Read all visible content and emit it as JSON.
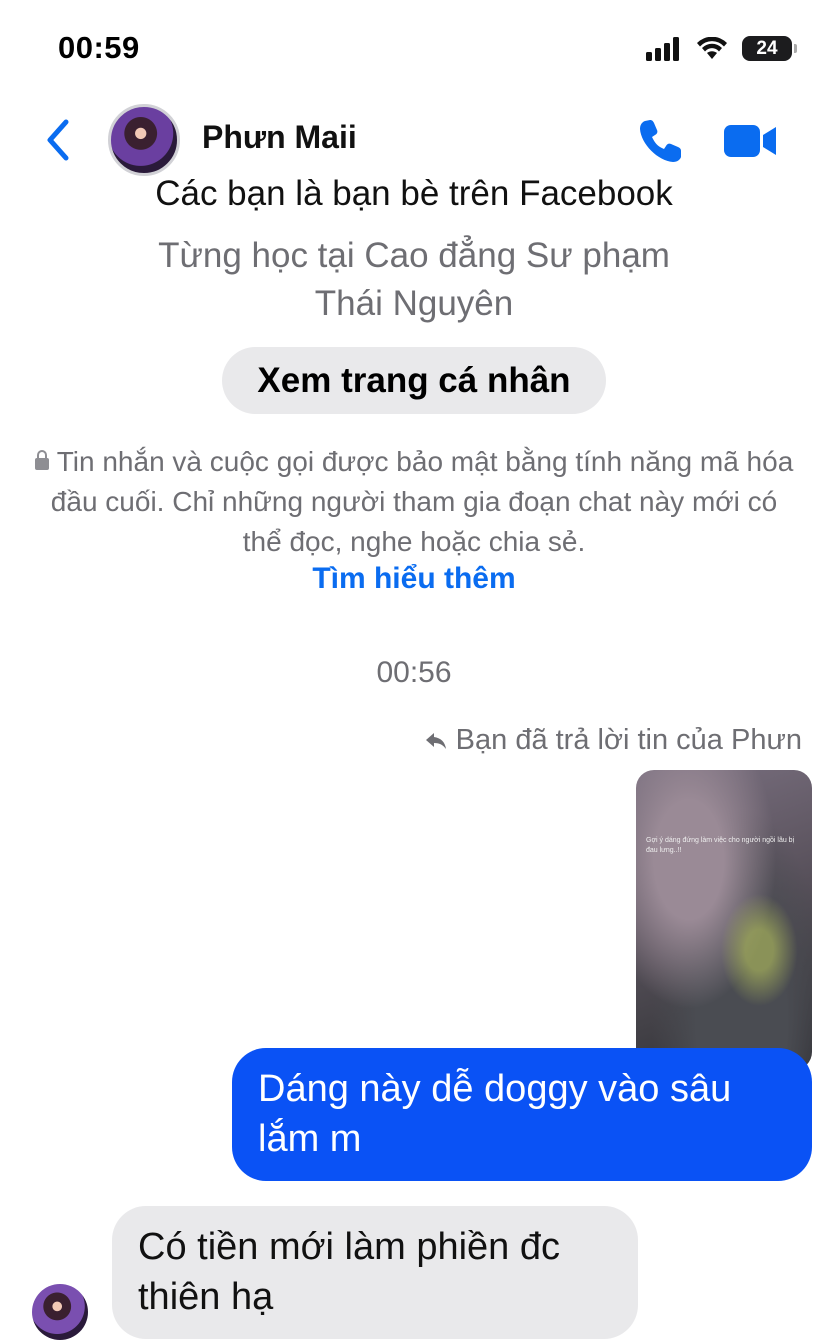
{
  "status_bar": {
    "time": "00:59",
    "battery": "24"
  },
  "header": {
    "contact_name": "Phưn Maii"
  },
  "profile": {
    "friends_text": "Các bạn là bạn bè trên Facebook",
    "studied_line1": "Từng học tại Cao đẳng Sư phạm",
    "studied_line2": "Thái Nguyên",
    "view_profile_label": "Xem trang cá nhân"
  },
  "encryption": {
    "notice": "Tin nhắn và cuộc gọi được bảo mật bằng tính năng mã hóa đầu cuối. Chỉ những người tham gia đoạn chat này mới có thể đọc, nghe hoặc chia sẻ.",
    "learn_more": "Tìm hiểu thêm"
  },
  "conversation": {
    "timestamp": "00:56",
    "reply_note": "Bạn đã trả lời tin của Phưn",
    "media_caption": "Gợi ý dáng đứng làm việc cho người ngồi lâu bị đau lưng..!!",
    "messages": [
      {
        "direction": "outgoing",
        "text": "Dáng này dễ doggy vào sâu lắm m"
      },
      {
        "direction": "incoming",
        "text": "Có tiền mới làm phiền đc thiên hạ"
      }
    ]
  },
  "colors": {
    "accent": "#0a6cf0",
    "outgoing_bubble": "#0a52f5",
    "incoming_bubble": "#e9e9eb"
  }
}
